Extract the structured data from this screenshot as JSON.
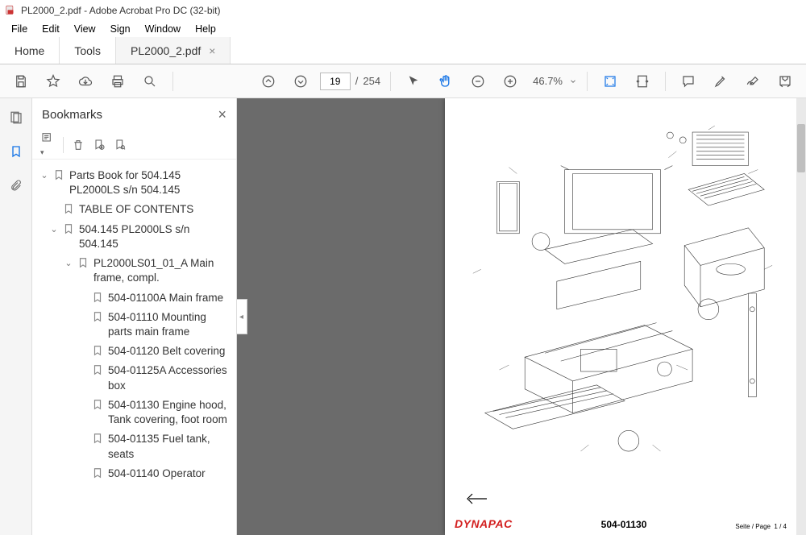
{
  "window": {
    "title": "PL2000_2.pdf - Adobe Acrobat Pro DC (32-bit)"
  },
  "menu": {
    "items": [
      "File",
      "Edit",
      "View",
      "Sign",
      "Window",
      "Help"
    ]
  },
  "tabs": {
    "home": "Home",
    "tools": "Tools",
    "doc": "PL2000_2.pdf"
  },
  "toolbar": {
    "page_current": "19",
    "page_total": "254",
    "page_sep": "/",
    "zoom": "46.7%"
  },
  "panel": {
    "title": "Bookmarks"
  },
  "bookmarks": {
    "root": "Parts Book for 504.145 PL2000LS s/n 504.145",
    "toc": "TABLE OF CONTENTS",
    "b1": "504.145 PL2000LS s/n 504.145",
    "b1_1": "PL2000LS01_01_A Main frame, compl.",
    "items": [
      "504-01100A Main frame",
      "504-01110 Mounting parts main frame",
      "504-01120 Belt covering",
      "504-01125A Accessories box",
      "504-01130 Engine hood, Tank covering, foot room",
      "504-01135 Fuel tank, seats",
      "504-01140 Operator"
    ]
  },
  "page": {
    "brand": "DYNAPAC",
    "partno": "504-01130",
    "pageno_label": "Seite / Page",
    "pageno": "1 / 4"
  }
}
